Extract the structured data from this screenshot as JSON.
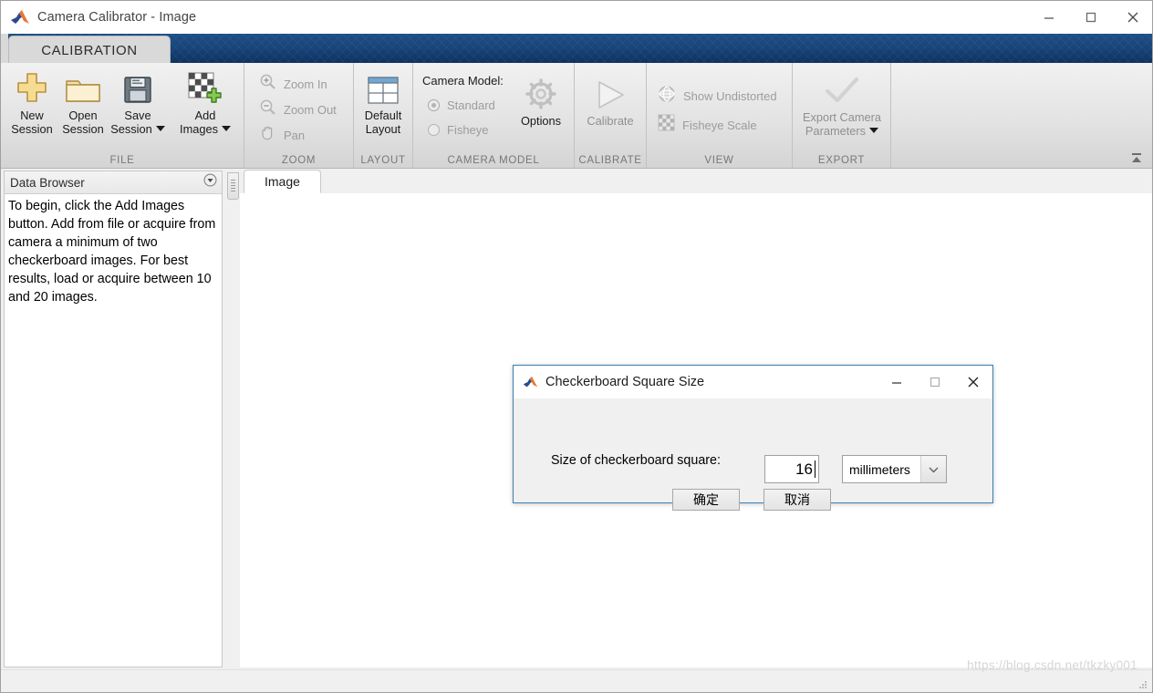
{
  "window": {
    "title": "Camera Calibrator - Image",
    "icon": "matlab-logo-icon",
    "minimize": "minimize-icon",
    "maximize": "maximize-icon",
    "close": "close-icon"
  },
  "ribbon": {
    "tab_label": "CALIBRATION",
    "collapse_label": "collapse-ribbon-icon",
    "quick_access": [
      {
        "name": "save-icon",
        "glyph": "save"
      },
      {
        "name": "cut-icon",
        "glyph": "cut"
      },
      {
        "name": "copy-icon",
        "glyph": "copy"
      },
      {
        "name": "paste-icon",
        "glyph": "paste"
      },
      {
        "name": "undo-icon",
        "glyph": "undo"
      },
      {
        "name": "redo-icon",
        "glyph": "redo"
      },
      {
        "name": "layout-icon",
        "glyph": "layout"
      },
      {
        "name": "help-icon",
        "glyph": "help"
      },
      {
        "name": "chevron-down-icon",
        "glyph": "chevron"
      }
    ],
    "groups": {
      "file": {
        "label": "FILE",
        "buttons": [
          {
            "line1": "New",
            "line2": "Session",
            "icon": "plus-icon",
            "dropdown": false
          },
          {
            "line1": "Open",
            "line2": "Session",
            "icon": "folder-icon",
            "dropdown": false
          },
          {
            "line1": "Save",
            "line2": "Session",
            "icon": "floppy-disk-icon",
            "dropdown": true
          },
          {
            "line1": "Add",
            "line2": "Images",
            "icon": "add-images-icon",
            "dropdown": true
          }
        ]
      },
      "zoom": {
        "label": "ZOOM",
        "items": [
          {
            "label": "Zoom In",
            "icon": "zoom-in-icon"
          },
          {
            "label": "Zoom Out",
            "icon": "zoom-out-icon"
          },
          {
            "label": "Pan",
            "icon": "pan-hand-icon"
          }
        ]
      },
      "layout": {
        "label": "LAYOUT",
        "button": {
          "line1": "Default",
          "line2": "Layout",
          "icon": "default-layout-icon"
        }
      },
      "camera_model": {
        "label": "CAMERA MODEL",
        "title": "Camera Model:",
        "options": [
          {
            "label": "Standard",
            "selected": true
          },
          {
            "label": "Fisheye",
            "selected": false
          }
        ],
        "options_button": {
          "label": "Options",
          "icon": "gear-icon"
        }
      },
      "calibrate": {
        "label": "CALIBRATE",
        "button": {
          "label": "Calibrate",
          "icon": "play-triangle-icon"
        }
      },
      "view": {
        "label": "VIEW",
        "items": [
          {
            "label": "Show Undistorted",
            "icon": "sphere-grid-icon"
          },
          {
            "label": "Fisheye Scale",
            "icon": "checkerboard-icon"
          }
        ]
      },
      "export": {
        "label": "EXPORT",
        "button": {
          "line1": "Export Camera",
          "line2": "Parameters",
          "icon": "checkmark-icon",
          "dropdown": true
        }
      }
    }
  },
  "data_browser": {
    "title": "Data Browser",
    "collapse_icon": "panel-collapse-icon",
    "message": "To begin, click the Add Images button. Add from file or acquire from camera a minimum of two checkerboard images. For best results, load or acquire between 10 and 20 images."
  },
  "document": {
    "tab_label": "Image"
  },
  "dialog": {
    "title": "Checkerboard Square Size",
    "icon": "matlab-logo-icon",
    "minimize": "minimize-icon",
    "maximize": "maximize-icon",
    "close": "close-icon",
    "field_label": "Size of checkerboard square:",
    "field_value": "16",
    "units_value": "millimeters",
    "units_arrow": "chevron-down-icon",
    "ok_label": "确定",
    "cancel_label": "取消"
  },
  "watermark": "https://blog.csdn.net/tkzky001",
  "colors": {
    "ribbon_banner": "#18457a",
    "dialog_border": "#3c7fb1",
    "ribbon_bg": "#e3e3e3"
  }
}
